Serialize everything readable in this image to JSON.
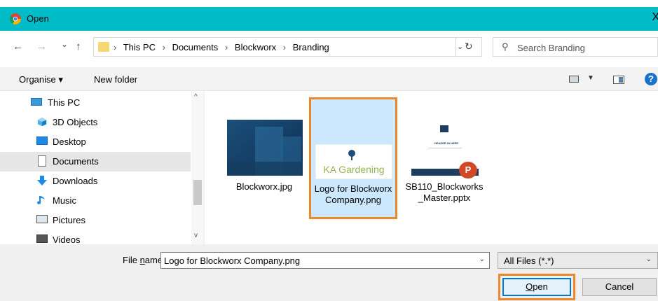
{
  "window": {
    "title": "Open",
    "close_glyph": "X"
  },
  "nav": {
    "back": "←",
    "forward": "→",
    "recent": "⌄",
    "up": "↑"
  },
  "address": {
    "crumbs": [
      "This PC",
      "Documents",
      "Blockworx",
      "Branding"
    ],
    "separator": "›",
    "dropdown": "⌄",
    "refresh": "↻"
  },
  "search": {
    "placeholder": "Search Branding",
    "icon": "⚲"
  },
  "toolbar": {
    "organise_label": "Organise ▾",
    "new_folder_label": "New folder",
    "view_dropdown": "▼",
    "help_label": "?"
  },
  "sidebar": {
    "items": [
      {
        "label": "This PC",
        "icon": "this-pc-icon"
      },
      {
        "label": "3D Objects",
        "icon": "3d-objects-icon"
      },
      {
        "label": "Desktop",
        "icon": "desktop-icon"
      },
      {
        "label": "Documents",
        "icon": "documents-icon",
        "selected": true
      },
      {
        "label": "Downloads",
        "icon": "downloads-icon"
      },
      {
        "label": "Music",
        "icon": "music-icon"
      },
      {
        "label": "Pictures",
        "icon": "pictures-icon"
      },
      {
        "label": "Videos",
        "icon": "videos-icon"
      }
    ],
    "scroll_up": "^",
    "scroll_down": "v"
  },
  "files": [
    {
      "name": "Blockworx.jpg",
      "kind": "image-photo"
    },
    {
      "name": "Logo for Blockworx Company.png",
      "kind": "logo",
      "selected": true,
      "logo_text": "KA Gardening"
    },
    {
      "name": "SB110_Blockworks_Master.pptx",
      "kind": "pptx",
      "slide_text": "HEADER IN HERE",
      "badge": "P"
    }
  ],
  "bottom": {
    "file_name_label_pre": "File ",
    "file_name_label_u": "n",
    "file_name_label_post": "ame:",
    "file_name_value": "Logo for Blockworx Company.png",
    "file_type": "All Files (*.*)",
    "dropdown": "⌄",
    "open_label_u": "O",
    "open_label_rest": "pen",
    "cancel_label": "Cancel"
  },
  "colors": {
    "titlebar": "#00bcc7",
    "selection": "#cce8ff",
    "highlight_outline": "#f0862a",
    "accent": "#0078d7"
  }
}
